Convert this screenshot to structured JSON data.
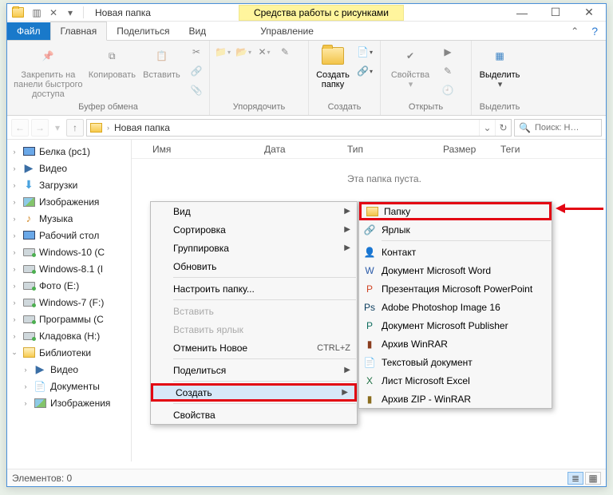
{
  "titlebar": {
    "title": "Новая папка",
    "contextual": "Средства работы с рисунками"
  },
  "tabs": {
    "file": "Файл",
    "home": "Главная",
    "share": "Поделиться",
    "view": "Вид",
    "manage": "Управление"
  },
  "ribbon": {
    "clipboard": {
      "label": "Буфер обмена",
      "pin": "Закрепить на панели быстрого доступа",
      "copy": "Копировать",
      "paste": "Вставить"
    },
    "organize": {
      "label": "Упорядочить"
    },
    "new": {
      "label": "Создать",
      "folder": "Создать папку"
    },
    "open": {
      "label": "Открыть",
      "props": "Свойства"
    },
    "select": {
      "label": "Выделить",
      "all": "Выделить"
    }
  },
  "address": {
    "path": "Новая папка",
    "search_ph": "Поиск: Н…"
  },
  "columns": {
    "name": "Имя",
    "date": "Дата",
    "type": "Тип",
    "size": "Размер",
    "tags": "Теги"
  },
  "empty": "Эта папка пуста.",
  "nav": [
    {
      "label": "Белка (pc1)",
      "icon": "pc"
    },
    {
      "label": "Видео",
      "icon": "vid"
    },
    {
      "label": "Загрузки",
      "icon": "dl"
    },
    {
      "label": "Изображения",
      "icon": "pic"
    },
    {
      "label": "Музыка",
      "icon": "music"
    },
    {
      "label": "Рабочий стол",
      "icon": "monitor"
    },
    {
      "label": "Windows-10 (С",
      "icon": "drive"
    },
    {
      "label": "Windows-8.1 (I",
      "icon": "drive"
    },
    {
      "label": "Фото (E:)",
      "icon": "drive"
    },
    {
      "label": "Windows-7 (F:)",
      "icon": "drive"
    },
    {
      "label": "Программы (С",
      "icon": "drive"
    },
    {
      "label": "Кладовка (H:)",
      "icon": "drive"
    },
    {
      "label": "Библиотеки",
      "icon": "libs",
      "caret": "down"
    },
    {
      "label": "Видео",
      "icon": "vid",
      "child": true
    },
    {
      "label": "Документы",
      "icon": "doc",
      "child": true
    },
    {
      "label": "Изображения",
      "icon": "pic",
      "child": true
    }
  ],
  "ctx1": [
    {
      "label": "Вид",
      "submenu": true
    },
    {
      "label": "Сортировка",
      "submenu": true
    },
    {
      "label": "Группировка",
      "submenu": true
    },
    {
      "label": "Обновить"
    },
    {
      "sep": true
    },
    {
      "label": "Настроить папку..."
    },
    {
      "sep": true
    },
    {
      "label": "Вставить",
      "disabled": true
    },
    {
      "label": "Вставить ярлык",
      "disabled": true
    },
    {
      "label": "Отменить Новое",
      "shortcut": "CTRL+Z"
    },
    {
      "sep": true
    },
    {
      "label": "Поделиться",
      "submenu": true
    },
    {
      "sep": true
    },
    {
      "label": "Создать",
      "submenu": true,
      "hi": true,
      "red": true
    },
    {
      "sep": true
    },
    {
      "label": "Свойства"
    }
  ],
  "ctx2": [
    {
      "label": "Папку",
      "icon": "folder",
      "red": true
    },
    {
      "label": "Ярлык",
      "icon": "link"
    },
    {
      "sep": true
    },
    {
      "label": "Контакт",
      "icon": "contact"
    },
    {
      "label": "Документ Microsoft Word",
      "icon": "word"
    },
    {
      "label": "Презентация Microsoft PowerPoint",
      "icon": "ppt"
    },
    {
      "label": "Adobe Photoshop Image 16",
      "icon": "ps"
    },
    {
      "label": "Документ Microsoft Publisher",
      "icon": "pub"
    },
    {
      "label": "Архив WinRAR",
      "icon": "rar"
    },
    {
      "label": "Текстовый документ",
      "icon": "txt"
    },
    {
      "label": "Лист Microsoft Excel",
      "icon": "xls"
    },
    {
      "label": "Архив ZIP - WinRAR",
      "icon": "zip"
    }
  ],
  "status": {
    "items": "Элементов: 0"
  }
}
